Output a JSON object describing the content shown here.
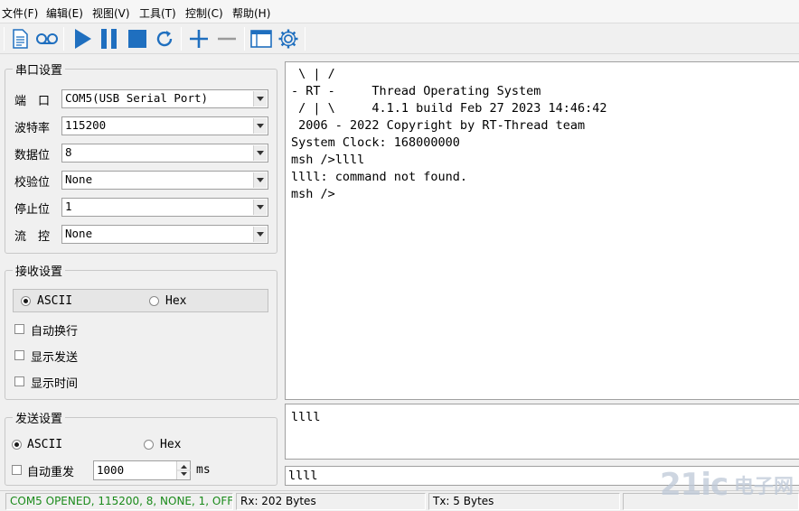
{
  "menu": [
    "文件(F)",
    "编辑(E)",
    "视图(V)",
    "工具(T)",
    "控制(C)",
    "帮助(H)"
  ],
  "toolbar": {
    "icons": [
      "new-file-icon",
      "record-icon",
      "play-icon",
      "pause-icon",
      "stop-icon",
      "refresh-icon",
      "plus-icon",
      "minus-icon",
      "window-icon",
      "settings-icon"
    ],
    "accent_color": "#1f6fbf"
  },
  "serial": {
    "title": "串口设置",
    "port_label": "端　口",
    "port_value": "COM5(USB Serial Port)",
    "baud_label": "波特率",
    "baud_value": "115200",
    "databits_label": "数据位",
    "databits_value": "8",
    "parity_label": "校验位",
    "parity_value": "None",
    "stopbits_label": "停止位",
    "stopbits_value": "1",
    "flow_label": "流　控",
    "flow_value": "None"
  },
  "receive": {
    "title": "接收设置",
    "ascii_label": "ASCII",
    "hex_label": "Hex",
    "auto_wrap_label": "自动换行",
    "show_send_label": "显示发送",
    "show_time_label": "显示时间"
  },
  "send": {
    "title": "发送设置",
    "ascii_label": "ASCII",
    "hex_label": "Hex",
    "auto_resend_label": "自动重发",
    "interval_value": "1000",
    "interval_unit": "ms"
  },
  "terminal": {
    "text": " \\ | /\n- RT -     Thread Operating System\n / | \\     4.1.1 build Feb 27 2023 14:46:42\n 2006 - 2022 Copyright by RT-Thread team\nSystem Clock: 168000000\nmsh />llll\nllll: command not found.\nmsh />"
  },
  "send_box": {
    "text": "llll"
  },
  "send_line": {
    "text": "llll"
  },
  "status": {
    "connection": "COM5 OPENED, 115200, 8, NONE, 1, OFF",
    "connection_color": "#1a8a1a",
    "rx": "Rx: 202 Bytes",
    "tx": "Tx: 5 Bytes"
  },
  "watermark": {
    "brand": "21ic",
    "cn": "电子网"
  }
}
